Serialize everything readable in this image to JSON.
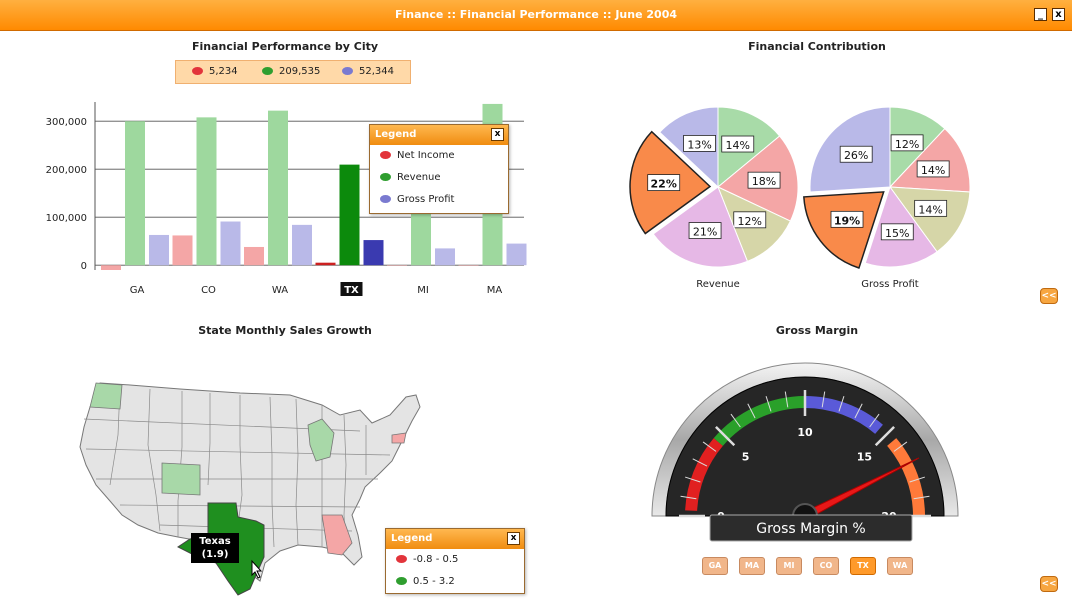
{
  "window": {
    "title": "Finance :: Financial Performance :: June 2004",
    "minimize_label": "_",
    "close_label": "x"
  },
  "bar_panel": {
    "title": "Financial Performance by City",
    "legend_strip": [
      {
        "value": "5,234",
        "color": "#e2343b"
      },
      {
        "value": "209,535",
        "color": "#2f9e2f"
      },
      {
        "value": "52,344",
        "color": "#7a7ad0"
      }
    ],
    "legend": {
      "title": "Legend",
      "close_label": "x",
      "items": [
        {
          "label": "Net Income",
          "color": "#e2343b"
        },
        {
          "label": "Revenue",
          "color": "#2f9e2f"
        },
        {
          "label": "Gross Profit",
          "color": "#7a7ad0"
        }
      ]
    },
    "selected_city": "TX"
  },
  "pie_panel": {
    "title": "Financial Contribution",
    "expand_label": "<<"
  },
  "map_panel": {
    "title": "State Monthly Sales Growth",
    "tooltip_state": "Texas",
    "tooltip_value": "(1.9)",
    "legend": {
      "title": "Legend",
      "close_label": "x",
      "items": [
        {
          "label": "-0.8 - 0.5",
          "color": "#e2343b"
        },
        {
          "label": "0.5 - 3.2",
          "color": "#2f9e2f"
        }
      ]
    }
  },
  "gauge_panel": {
    "title": "Gross Margin",
    "gauge_label": "Gross Margin %",
    "gauge_value": 17,
    "scale": {
      "min": 0,
      "max": 20,
      "labels": [
        "0",
        "5",
        "10",
        "15",
        "20"
      ]
    },
    "state_buttons": [
      "GA",
      "MA",
      "MI",
      "CO",
      "TX",
      "WA"
    ],
    "active_state": "TX",
    "expand_label": "<<"
  },
  "chart_data": [
    {
      "type": "bar",
      "title": "Financial Performance by City",
      "categories": [
        "GA",
        "CO",
        "WA",
        "TX",
        "MI",
        "MA"
      ],
      "ylim": [
        -10000,
        340000
      ],
      "yticks": [
        "0",
        "100,000",
        "200,000",
        "300,000"
      ],
      "grid": true,
      "legend_position": "top-right",
      "series": [
        {
          "name": "Net Income",
          "color": "#f4a6a6",
          "values": [
            -10000,
            62000,
            38000,
            5234,
            0,
            0
          ]
        },
        {
          "name": "Revenue",
          "color": "#9ed89e",
          "values": [
            300000,
            308000,
            322000,
            209535,
            140000,
            336000
          ]
        },
        {
          "name": "Gross Profit",
          "color": "#b9b9e8",
          "values": [
            63000,
            91000,
            84000,
            52344,
            35000,
            45000
          ]
        }
      ]
    },
    {
      "type": "pie",
      "xlabel": "Revenue",
      "slices": [
        {
          "value": 14,
          "label": "14%",
          "color": "#a8dba8"
        },
        {
          "value": 18,
          "label": "18%",
          "color": "#f4a6a6"
        },
        {
          "value": 12,
          "label": "12%",
          "color": "#d6d6a8"
        },
        {
          "value": 21,
          "label": "21%",
          "color": "#e6b8e6"
        },
        {
          "value": 22,
          "label": "22%",
          "color": "#f98a4a",
          "exploded": true
        },
        {
          "value": 13,
          "label": "13%",
          "color": "#b9b9e8"
        }
      ]
    },
    {
      "type": "pie",
      "xlabel": "Gross Profit",
      "slices": [
        {
          "value": 12,
          "label": "12%",
          "color": "#a8dba8"
        },
        {
          "value": 14,
          "label": "14%",
          "color": "#f4a6a6"
        },
        {
          "value": 14,
          "label": "14%",
          "color": "#d6d6a8"
        },
        {
          "value": 15,
          "label": "15%",
          "color": "#e6b8e6"
        },
        {
          "value": 19,
          "label": "19%",
          "color": "#f98a4a",
          "exploded": true
        },
        {
          "value": 26,
          "label": "26%",
          "color": "#b9b9e8"
        }
      ]
    }
  ]
}
